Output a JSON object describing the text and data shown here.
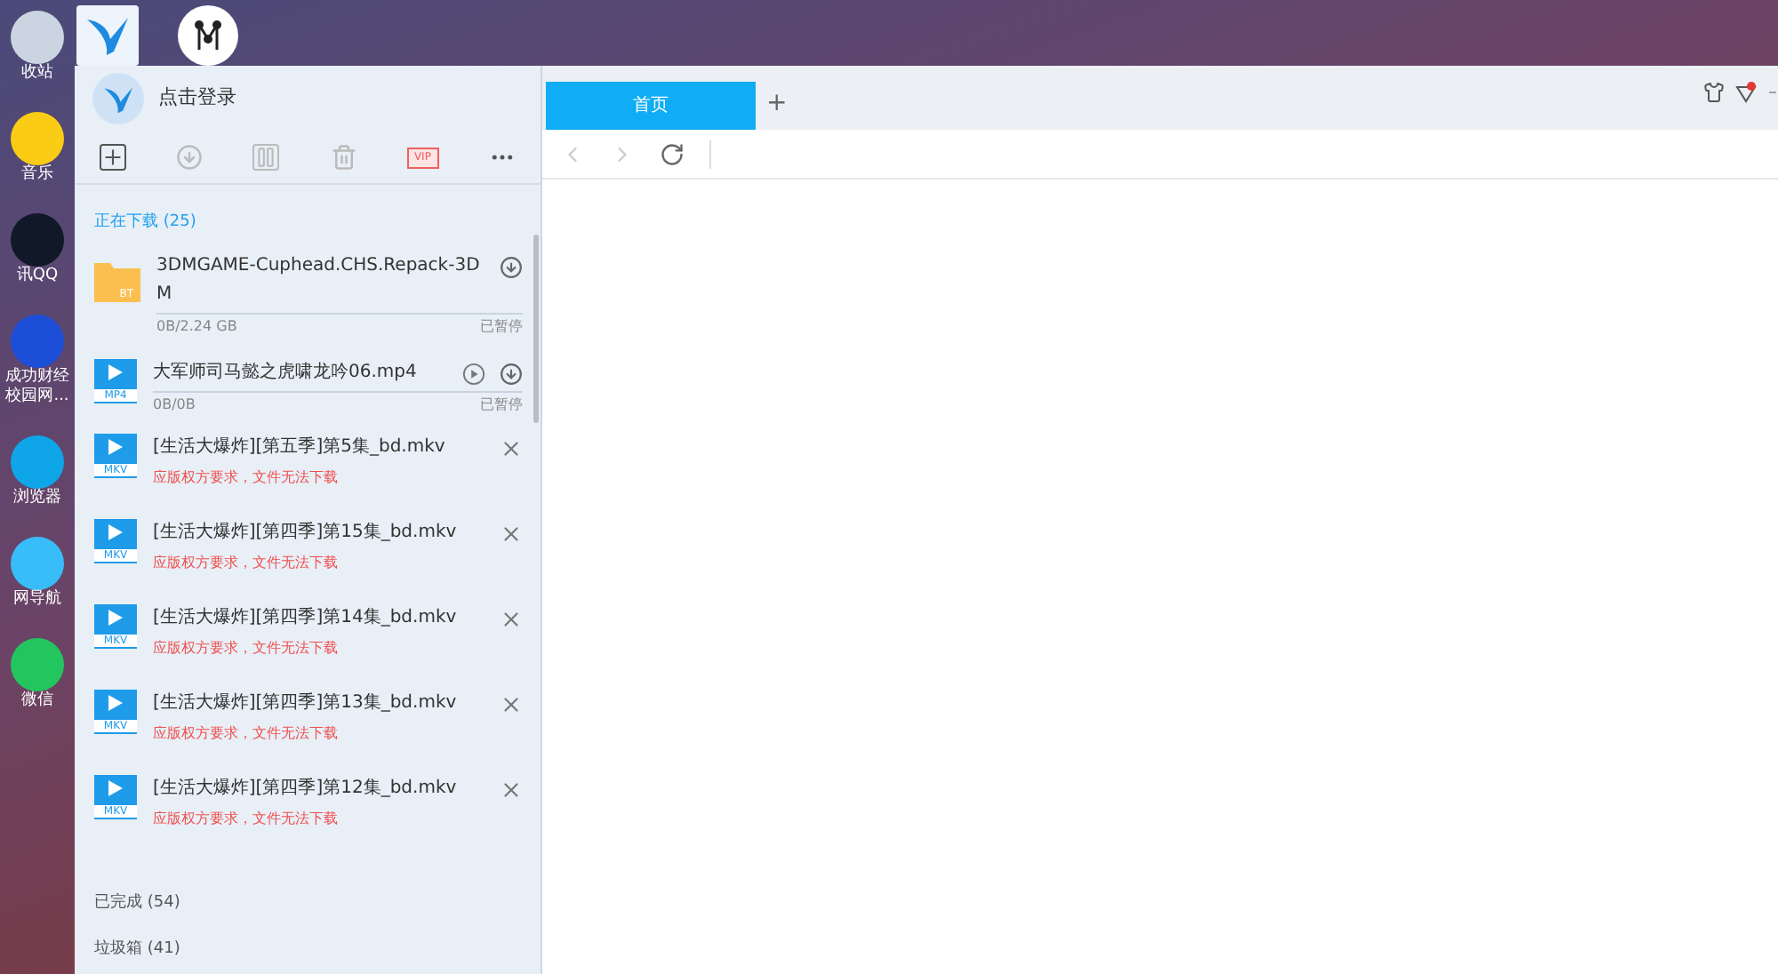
{
  "desktop": {
    "icons": [
      {
        "label": "收站"
      },
      {
        "label": "音乐"
      },
      {
        "label": "讯QQ"
      },
      {
        "label": "成功财经校园网..."
      },
      {
        "label": "浏览器"
      },
      {
        "label": "网导航"
      },
      {
        "label": "微信"
      }
    ]
  },
  "app": {
    "login": "点击登录",
    "downloading": {
      "title": "正在下载 (25)",
      "items": [
        {
          "kind": "bt",
          "name": "3DMGAME-Cuphead.CHS.Repack-3DM",
          "badge": "BT",
          "progress": "0B/2.24 GB",
          "status": "已暂停"
        },
        {
          "kind": "video",
          "name": "大军师司马懿之虎啸龙吟06.mp4",
          "badge": "MP4",
          "progress": "0B/0B",
          "status": "已暂停"
        },
        {
          "kind": "error",
          "name": "[生活大爆炸][第五季]第5集_bd.mkv",
          "badge": "MKV",
          "error": "应版权方要求，文件无法下载"
        },
        {
          "kind": "error",
          "name": "[生活大爆炸][第四季]第15集_bd.mkv",
          "badge": "MKV",
          "error": "应版权方要求，文件无法下载"
        },
        {
          "kind": "error",
          "name": "[生活大爆炸][第四季]第14集_bd.mkv",
          "badge": "MKV",
          "error": "应版权方要求，文件无法下载"
        },
        {
          "kind": "error",
          "name": "[生活大爆炸][第四季]第13集_bd.mkv",
          "badge": "MKV",
          "error": "应版权方要求，文件无法下载"
        },
        {
          "kind": "error",
          "name": "[生活大爆炸][第四季]第12集_bd.mkv",
          "badge": "MKV",
          "error": "应版权方要求，文件无法下载"
        }
      ]
    },
    "vip": "VIP",
    "completed": "已完成 (54)",
    "trash": "垃圾箱 (41)",
    "tabs": [
      {
        "label": "首页",
        "selected": true
      }
    ],
    "new_tab": "+"
  }
}
